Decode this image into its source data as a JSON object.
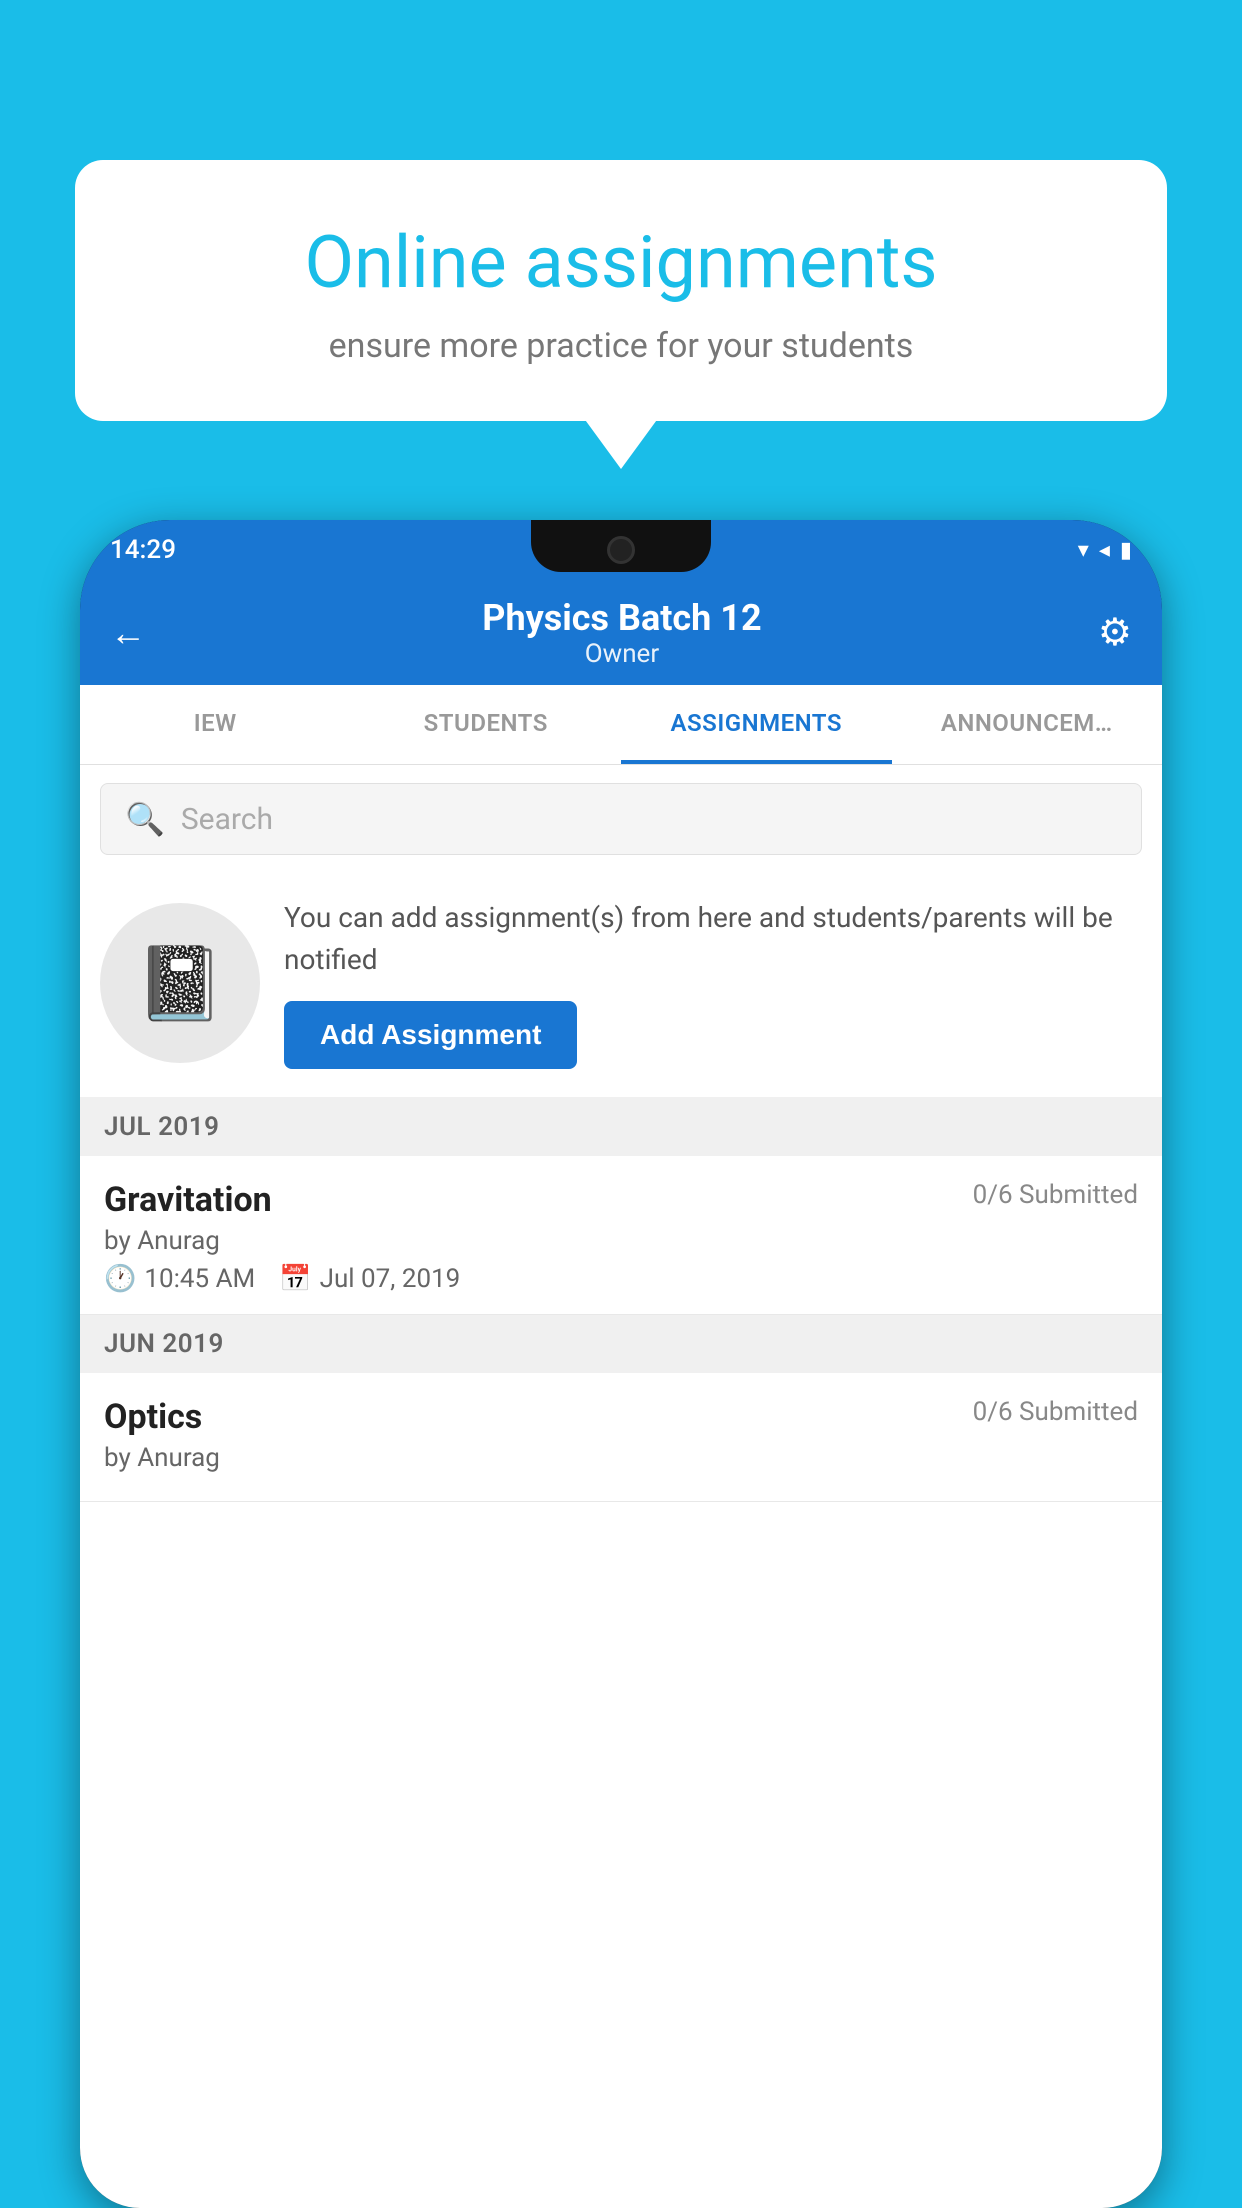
{
  "background": {
    "color": "#1ABDE8"
  },
  "speech_bubble": {
    "title": "Online assignments",
    "subtitle": "ensure more practice for your students"
  },
  "phone": {
    "status_bar": {
      "time": "14:29",
      "signal_icons": "▾◂▮"
    },
    "header": {
      "back_icon": "←",
      "title": "Physics Batch 12",
      "subtitle": "Owner",
      "gear_icon": "⚙"
    },
    "tabs": [
      {
        "label": "IEW",
        "active": false
      },
      {
        "label": "STUDENTS",
        "active": false
      },
      {
        "label": "ASSIGNMENTS",
        "active": true
      },
      {
        "label": "ANNOUNCEM…",
        "active": false
      }
    ],
    "search": {
      "placeholder": "Search",
      "icon": "🔍"
    },
    "promo": {
      "description": "You can add assignment(s) from here and students/parents will be notified",
      "add_button_label": "Add Assignment"
    },
    "sections": [
      {
        "label": "JUL 2019",
        "assignments": [
          {
            "name": "Gravitation",
            "submitted": "0/6 Submitted",
            "author": "by Anurag",
            "time": "10:45 AM",
            "date": "Jul 07, 2019"
          }
        ]
      },
      {
        "label": "JUN 2019",
        "assignments": [
          {
            "name": "Optics",
            "submitted": "0/6 Submitted",
            "author": "by Anurag",
            "time": "",
            "date": ""
          }
        ]
      }
    ]
  }
}
